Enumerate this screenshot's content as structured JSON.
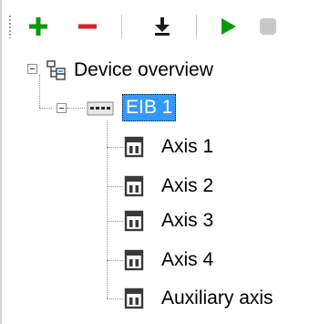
{
  "toolbar": {
    "buttons": [
      {
        "name": "add-button",
        "icon": "plus-icon",
        "color": "#0a9a0a"
      },
      {
        "name": "remove-button",
        "icon": "minus-icon",
        "color": "#e02020"
      },
      {
        "name": "download-button",
        "icon": "download-arrow-icon",
        "color": "#1a1a1a"
      },
      {
        "name": "start-button",
        "icon": "play-icon",
        "color": "#0a9a0a"
      },
      {
        "name": "stop-button",
        "icon": "stop-icon",
        "color": "#c8c8c8",
        "disabled": true
      }
    ]
  },
  "tree": {
    "root": {
      "label": "Device overview",
      "icon": "tree-structure-icon",
      "expanded": true,
      "children": [
        {
          "label": "EIB 1",
          "icon": "device-icon",
          "expanded": true,
          "selected": true,
          "children": [
            {
              "label": "Axis 1",
              "icon": "connector-icon"
            },
            {
              "label": "Axis 2",
              "icon": "connector-icon"
            },
            {
              "label": "Axis 3",
              "icon": "connector-icon"
            },
            {
              "label": "Axis 4",
              "icon": "connector-icon"
            },
            {
              "label": "Auxiliary axis",
              "icon": "connector-icon"
            }
          ]
        }
      ]
    }
  },
  "colors": {
    "selection": "#3399ff",
    "add": "#0a9a0a",
    "remove": "#e02020",
    "play": "#0a9a0a",
    "disabled": "#c8c8c8"
  }
}
